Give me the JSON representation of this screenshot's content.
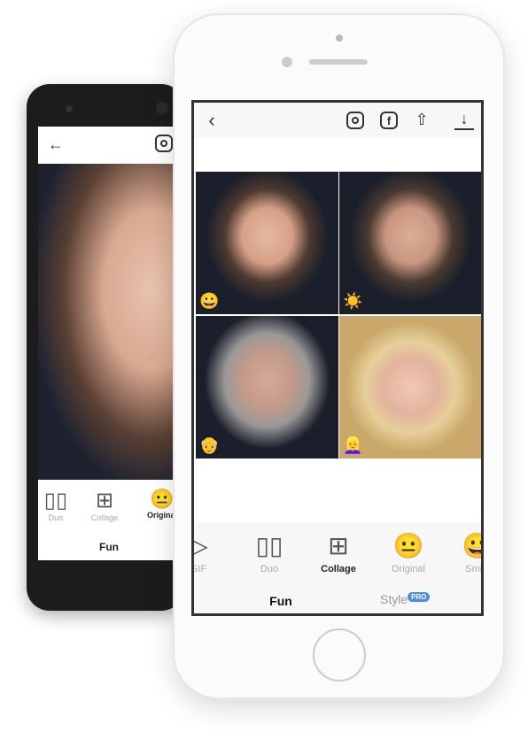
{
  "android": {
    "tools": [
      {
        "label": "Duo",
        "icon": "duo-icon"
      },
      {
        "label": "Collage",
        "icon": "collage-icon"
      },
      {
        "label": "Original",
        "icon": "neutral-face-icon",
        "active": true
      }
    ],
    "tab": "Fun"
  },
  "iphone": {
    "header_icons": [
      "back-icon",
      "instagram-icon",
      "facebook-icon",
      "share-icon",
      "download-icon"
    ],
    "cells": [
      {
        "filter": "smile",
        "emoji": "😀"
      },
      {
        "filter": "beard",
        "emoji": "☀️"
      },
      {
        "filter": "old",
        "emoji": "👴"
      },
      {
        "filter": "female",
        "emoji": "👱‍♀️"
      }
    ],
    "tools": [
      {
        "label": "GIF",
        "icon": "gif-icon"
      },
      {
        "label": "Duo",
        "icon": "duo-icon"
      },
      {
        "label": "Collage",
        "icon": "collage-icon",
        "active": true
      },
      {
        "label": "Original",
        "icon": "neutral-face-icon"
      },
      {
        "label": "Smile",
        "icon": "smile-icon"
      }
    ],
    "tabs": [
      {
        "label": "Fun",
        "active": true
      },
      {
        "label": "Style",
        "badge": "PRO"
      }
    ]
  },
  "colors": {
    "accent": "#4a8fe0",
    "android_body": "#1c1c1c",
    "iphone_body": "#fbfbfb"
  }
}
